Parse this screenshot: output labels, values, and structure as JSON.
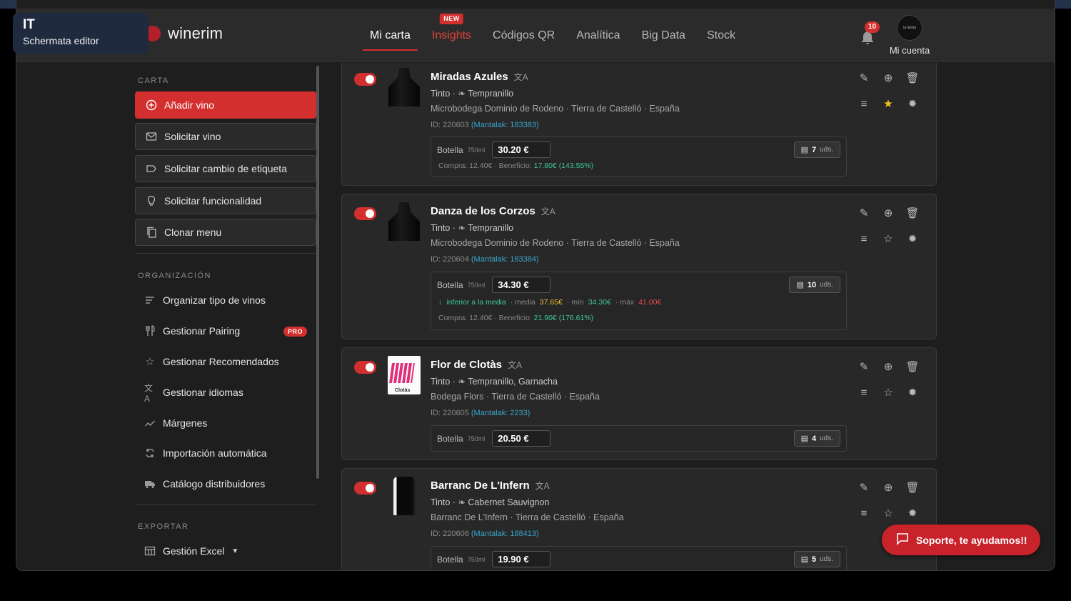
{
  "editor_tag": {
    "lang": "IT",
    "desc": "Schermata editor"
  },
  "brand": {
    "name": "winerim"
  },
  "nav": {
    "items": [
      {
        "label": "Mi carta",
        "active": true
      },
      {
        "label": "Insights",
        "badge": "NEW"
      },
      {
        "label": "Códigos QR"
      },
      {
        "label": "Analítica"
      },
      {
        "label": "Big Data"
      },
      {
        "label": "Stock"
      }
    ]
  },
  "notifications": {
    "count": "10"
  },
  "account": {
    "label": "Mi cuenta"
  },
  "sidebar": {
    "section_carta": "CARTA",
    "buttons": [
      {
        "label": "Añadir vino",
        "icon": "plus-circle-icon"
      },
      {
        "label": "Solicitar vino",
        "icon": "mail-icon"
      },
      {
        "label": "Solicitar cambio de etiqueta",
        "icon": "label-icon"
      },
      {
        "label": "Solicitar funcionalidad",
        "icon": "lightbulb-icon"
      },
      {
        "label": "Clonar menu",
        "icon": "copy-icon"
      }
    ],
    "section_org": "ORGANIZACIÓN",
    "links": [
      {
        "label": "Organizar tipo de vinos",
        "icon": "sort-icon"
      },
      {
        "label": "Gestionar Pairing",
        "icon": "cutlery-icon",
        "badge": "PRO"
      },
      {
        "label": "Gestionar Recomendados",
        "icon": "star-icon"
      },
      {
        "label": "Gestionar idiomas",
        "icon": "translate-icon"
      },
      {
        "label": "Márgenes",
        "icon": "trend-icon"
      },
      {
        "label": "Importación automática",
        "icon": "sync-icon"
      },
      {
        "label": "Catálogo distribuidores",
        "icon": "truck-icon"
      }
    ],
    "section_export": "EXPORTAR",
    "export_link": {
      "label": "Gestión Excel",
      "icon": "table-icon"
    }
  },
  "wines": [
    {
      "name": "Miradas Azules",
      "type": "Tinto ·",
      "grape": "Tempranillo",
      "origin": "Microbodega Dominio de Rodeno · Tierra de Castelló · España",
      "id": "ID: 220603",
      "mantalak": "(Mantalak: 183383)",
      "format": "Botella",
      "ml": "750ml",
      "price": "30.20 €",
      "stock_qty": "7",
      "stock_unit": "uds.",
      "compra": "Compra: 12.40€ · Beneficio: ",
      "beneficio": "17.80€ (143.55%)",
      "favorite": true
    },
    {
      "name": "Danza de los Corzos",
      "type": "Tinto ·",
      "grape": "Tempranillo",
      "origin": "Microbodega Dominio de Rodeno · Tierra de Castelló · España",
      "id": "ID: 220604",
      "mantalak": "(Mantalak: 183384)",
      "format": "Botella",
      "ml": "750ml",
      "price": "34.30 €",
      "stock_qty": "10",
      "stock_unit": "uds.",
      "avg_below": "inferior a la media",
      "avg_media_label": "· media",
      "avg_media": "37.65€",
      "avg_min_label": "· mín",
      "avg_min": "34.30€",
      "avg_max_label": "· máx",
      "avg_max": "41.00€",
      "compra": "Compra: 12.40€ · Beneficio: ",
      "beneficio": "21.90€ (176.61%)",
      "favorite": false
    },
    {
      "name": "Flor de Clotàs",
      "type": "Tinto ·",
      "grape": "Tempranillo, Garnacha",
      "origin": "Bodega Flors · Tierra de Castelló · España",
      "id": "ID: 220605",
      "mantalak": "(Mantalak: 2233)",
      "format": "Botella",
      "ml": "750ml",
      "price": "20.50 €",
      "stock_qty": "4",
      "stock_unit": "uds.",
      "favorite": false
    },
    {
      "name": "Barranc De L'Infern",
      "type": "Tinto ·",
      "grape": "Cabernet Sauvignon",
      "origin": "Barranc De L'Infern · Tierra de Castelló · España",
      "id": "ID: 220606",
      "mantalak": "(Mantalak: 188413)",
      "format": "Botella",
      "ml": "750ml",
      "price": "19.90 €",
      "stock_qty": "5",
      "stock_unit": "uds.",
      "favorite": false
    }
  ],
  "support": {
    "label": "Soporte, te ayudamos!!"
  },
  "colors": {
    "accent": "#d32f2f",
    "link": "#3aa5c9",
    "positive": "#3ec79a",
    "star": "#f5c518"
  }
}
